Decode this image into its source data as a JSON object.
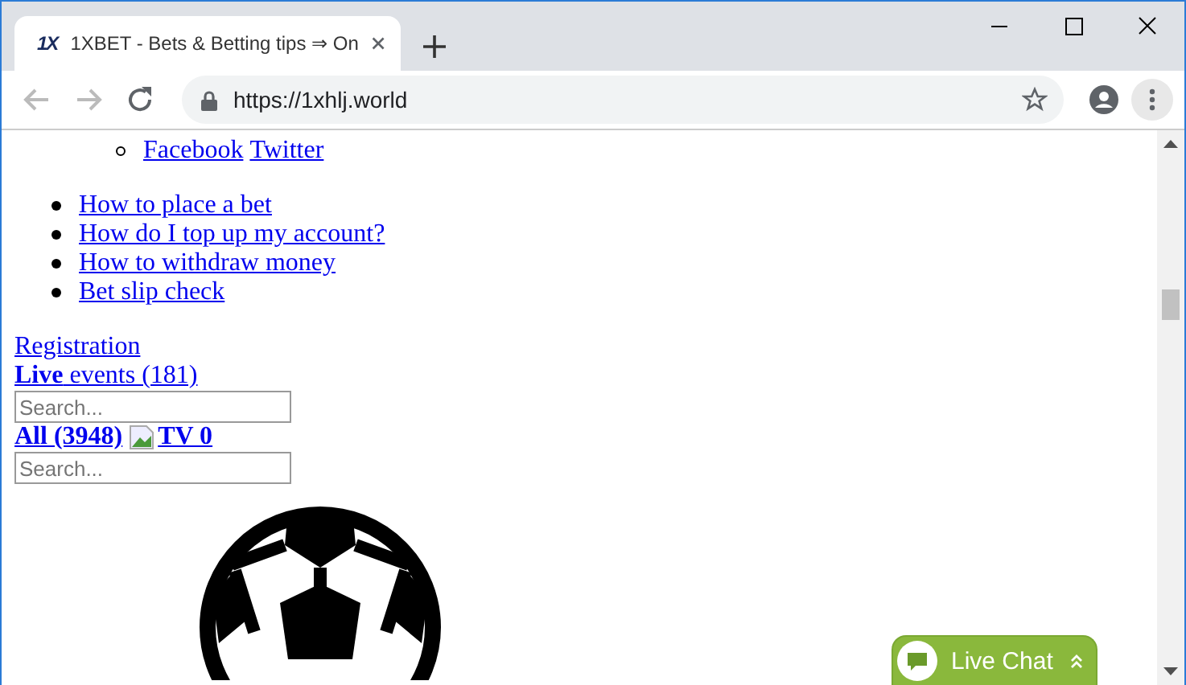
{
  "browser": {
    "tab": {
      "favicon": "1X",
      "title": "1XBET - Bets & Betting tips ⇒ On"
    },
    "address": "https://1xhlj.world"
  },
  "page": {
    "social_links": [
      "Facebook",
      "Twitter"
    ],
    "help_links": [
      "How to place a bet",
      "How do I top up my account?",
      "How to withdraw money",
      "Bet slip check"
    ],
    "registration": "Registration",
    "live_events": "**Live** events (181)",
    "live_search": {
      "placeholder": "Search..."
    },
    "all_link": "All (3948)",
    "tv_link": "TV 0",
    "all_search": {
      "placeholder": "Search..."
    },
    "live_chat": "Live Chat"
  }
}
